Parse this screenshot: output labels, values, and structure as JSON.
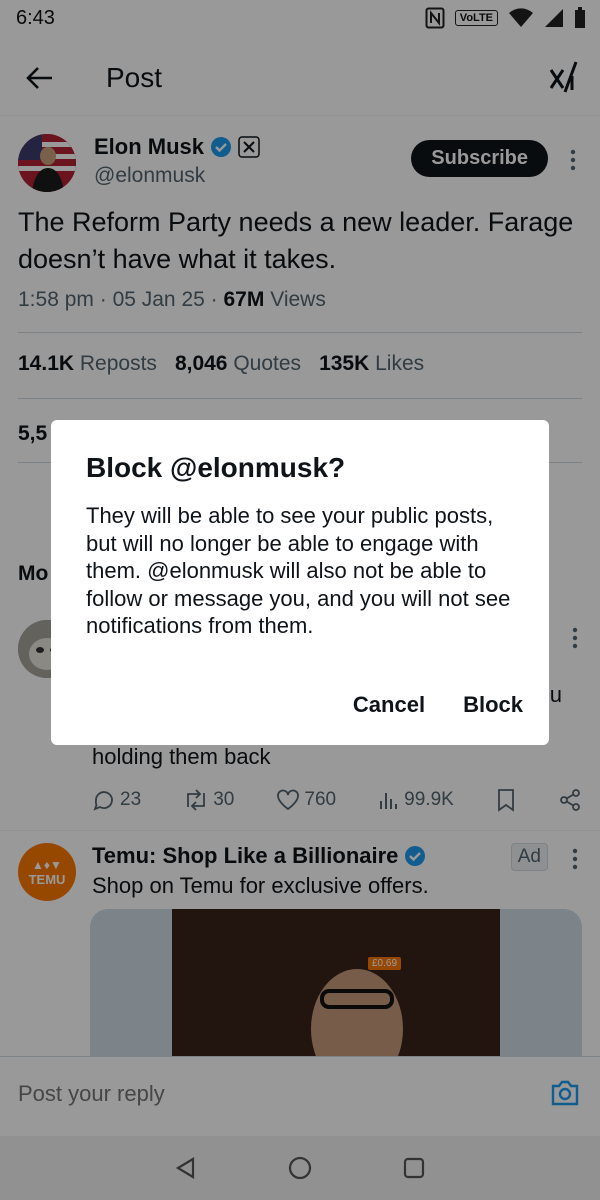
{
  "status_bar": {
    "time": "6:43",
    "network_label": "VoLTE"
  },
  "header": {
    "title": "Post"
  },
  "post": {
    "author_name": "Elon Musk",
    "author_handle": "@elonmusk",
    "subscribe_label": "Subscribe",
    "text": "The Reform Party needs a new leader. Farage doesn’t have what it takes.",
    "time": "1:58 pm",
    "date": "05 Jan 25",
    "views_count": "67M",
    "views_label": "Views",
    "reposts_count": "14.1K",
    "reposts_label": "Reposts",
    "quotes_count": "8,046",
    "quotes_label": "Quotes",
    "likes_count": "135K",
    "likes_label": "Likes",
    "bookmarks_count_partial": "5,5"
  },
  "more_replies_partial": "Mo",
  "reply": {
    "visible_text": "holding them back",
    "trailing_char": "u",
    "replies": "23",
    "reposts": "30",
    "likes": "760",
    "views": "99.9K"
  },
  "ad": {
    "avatar_text": "TEMU",
    "title": "Temu: Shop Like a Billionaire",
    "subtitle": "Shop on Temu for exclusive offers.",
    "badge": "Ad",
    "price_text": "£0.69"
  },
  "reply_bar": {
    "placeholder": "Post your reply"
  },
  "dialog": {
    "title": "Block @elonmusk?",
    "body": "They will be able to see your public posts, but will no longer be able to engage with them. @elonmusk will also not be able to follow or message you, and you will not see notifications from them.",
    "cancel_label": "Cancel",
    "confirm_label": "Block"
  },
  "colors": {
    "verified_blue": "#1d9bf0",
    "temu_orange": "#fb7701",
    "text_primary": "#0f1419",
    "text_secondary": "#536471"
  }
}
